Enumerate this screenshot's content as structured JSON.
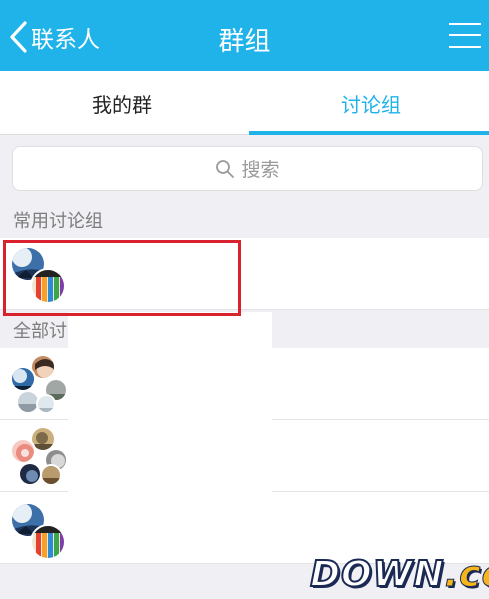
{
  "header": {
    "back_label": "联系人",
    "title": "群组",
    "back_icon": "chevron-left-icon",
    "menu_icon": "hamburger-menu-icon",
    "color": "#1fb3ea"
  },
  "tabs": [
    {
      "label": "我的群",
      "active": false
    },
    {
      "label": "讨论组",
      "active": true
    }
  ],
  "search": {
    "placeholder": "搜索",
    "icon": "search-icon"
  },
  "sections": {
    "frequent": {
      "title": "常用讨论组"
    },
    "all": {
      "title": "全部讨"
    }
  },
  "highlight_color": "#d8232f",
  "watermark": {
    "main": "DOWN",
    "suffix": ".cc"
  }
}
